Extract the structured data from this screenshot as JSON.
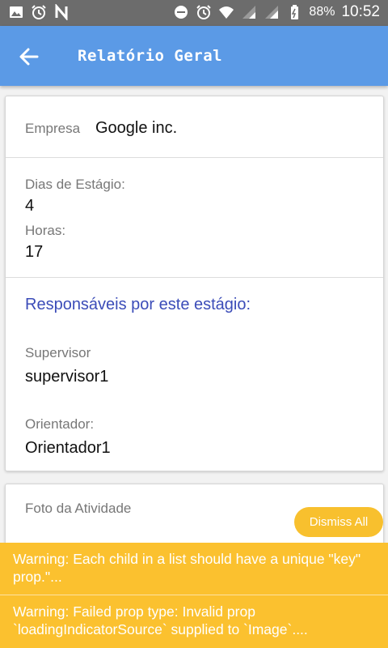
{
  "status_bar": {
    "battery": "88%",
    "time": "10:52",
    "icons_left": [
      "image-icon",
      "alarm-icon",
      "n-icon"
    ],
    "icons_right": [
      "dnd-icon",
      "alarm-icon",
      "wifi-icon",
      "signal-icon",
      "signal-icon",
      "battery-icon"
    ]
  },
  "app_bar": {
    "title": "Relatório Geral",
    "back_icon": "arrow-left-icon",
    "color": "#5b9ae6"
  },
  "card_info": {
    "empresa_label": "Empresa",
    "empresa_value": "Google inc.",
    "dias_label": "Dias de Estágio:",
    "dias_value": "4",
    "horas_label": "Horas:",
    "horas_value": "17",
    "responsaveis_title": "Responsáveis por este estágio:",
    "supervisor_label": "Supervisor",
    "supervisor_value": "supervisor1",
    "orientador_label": "Orientador:",
    "orientador_value": "Orientador1"
  },
  "card_photo": {
    "label": "Foto da Atividade"
  },
  "dismiss_all": "Dismiss All",
  "warnings": [
    "Warning: Each child in a list should have a unique \"key\" prop.\"...",
    "Warning: Failed prop type: Invalid prop `loadingIndicatorSource` supplied to `Image`...."
  ],
  "colors": {
    "accent": "#3b4cb8",
    "warning": "#fbc12f",
    "dismiss": "#f8c02e"
  }
}
